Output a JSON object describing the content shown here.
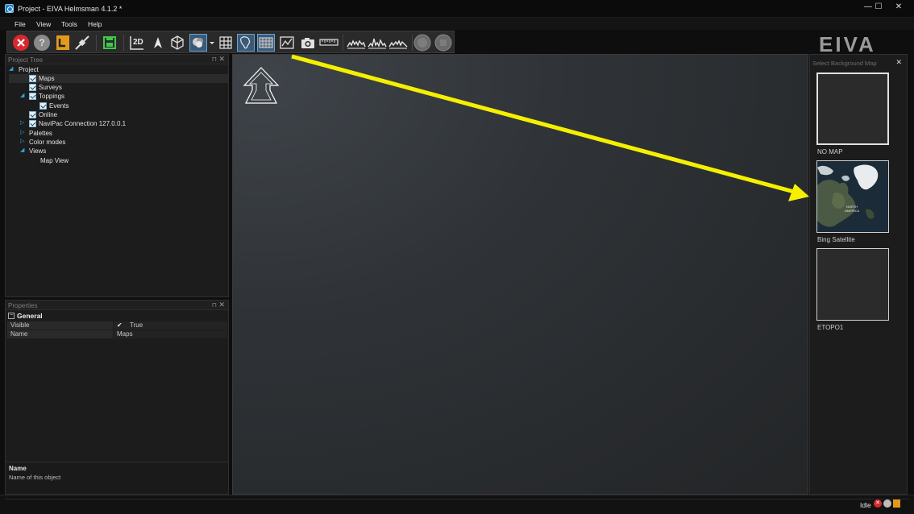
{
  "window": {
    "title": "Project - EIVA Helmsman 4.1.2 *",
    "minimize": "—",
    "maximize": "☐",
    "close": "✕"
  },
  "menu": [
    "File",
    "View",
    "Tools",
    "Help"
  ],
  "toolbar": {
    "view_2d_label": "2D"
  },
  "brand": {
    "logo_text": "EIVA"
  },
  "project_tree": {
    "title": "Project Tree",
    "items": [
      {
        "label": "Project"
      },
      {
        "label": "Maps"
      },
      {
        "label": "Surveys"
      },
      {
        "label": "Toppings"
      },
      {
        "label": "Events"
      },
      {
        "label": "Online"
      },
      {
        "label": "NaviPac Connection 127.0.0.1"
      },
      {
        "label": "Palettes"
      },
      {
        "label": "Color modes"
      },
      {
        "label": "Views"
      },
      {
        "label": "Map View"
      }
    ]
  },
  "properties": {
    "title": "Properties",
    "group": "General",
    "rows": [
      {
        "name": "Visible",
        "value": "True"
      },
      {
        "name": "Name",
        "value": "Maps"
      }
    ],
    "help_title": "Name",
    "help_text": "Name of this object"
  },
  "background_map": {
    "title": "Select Background Map",
    "options": [
      {
        "label": "NO MAP"
      },
      {
        "label": "Bing Satellite"
      },
      {
        "label": "ETOPO1"
      }
    ],
    "satellite_caption_1": "NORTH",
    "satellite_caption_2": "AMERICA"
  },
  "status": {
    "text": "Idle"
  },
  "colors": {
    "accent": "#2aa6d6",
    "annotation_arrow": "#f5f000",
    "stop_red": "#d9282d",
    "warning_orange": "#e39a1b"
  }
}
